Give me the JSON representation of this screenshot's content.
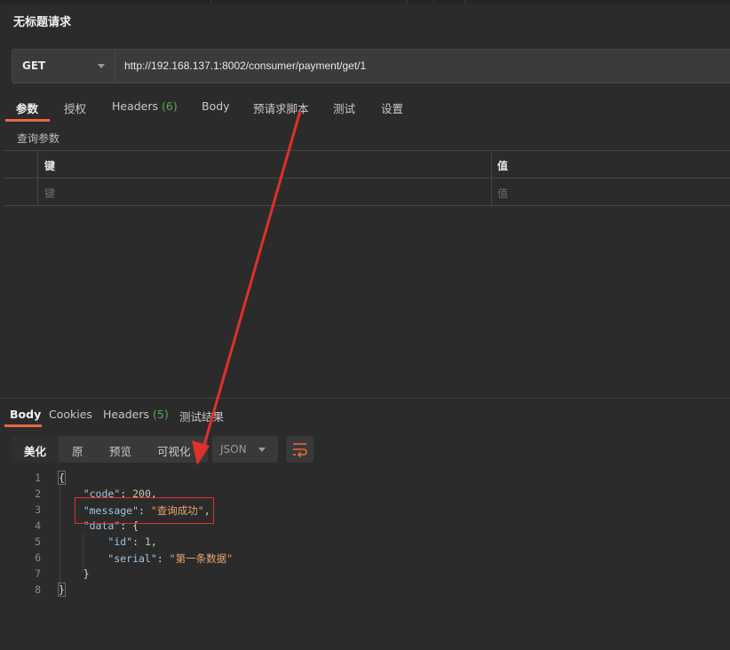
{
  "request": {
    "title": "无标题请求",
    "method": "GET",
    "url": "http://192.168.137.1:8002/consumer/payment/get/1"
  },
  "request_tabs": [
    {
      "label": "参数",
      "active": true
    },
    {
      "label": "授权"
    },
    {
      "label": "Headers",
      "count": "(6)"
    },
    {
      "label": "Body"
    },
    {
      "label": "预请求脚本"
    },
    {
      "label": "测试"
    },
    {
      "label": "设置"
    }
  ],
  "params": {
    "section_title": "查询参数",
    "columns": [
      "键",
      "值"
    ],
    "placeholders": [
      "键",
      "值"
    ]
  },
  "response_tabs": [
    {
      "label": "Body",
      "active": true
    },
    {
      "label": "Cookies"
    },
    {
      "label": "Headers",
      "count": "(5)"
    },
    {
      "label": "测试结果"
    }
  ],
  "view_modes": [
    {
      "label": "美化",
      "active": true
    },
    {
      "label": "原"
    },
    {
      "label": "预览"
    },
    {
      "label": "可视化"
    }
  ],
  "format_select": {
    "value": "JSON"
  },
  "wrap_icon": "wrap-lines-icon",
  "response_body": {
    "line_numbers": [
      "1",
      "2",
      "3",
      "4",
      "5",
      "6",
      "7",
      "8"
    ],
    "lines": [
      [
        "{"
      ],
      [
        "\"code\"",
        ": ",
        "200",
        ","
      ],
      [
        "\"message\"",
        ": ",
        "\"查询成功\"",
        ","
      ],
      [
        "\"data\"",
        ": {"
      ],
      [
        "\"id\"",
        ": ",
        "1",
        ","
      ],
      [
        "\"serial\"",
        ": ",
        "\"第一条数据\""
      ],
      [
        "}"
      ],
      [
        "}"
      ]
    ]
  },
  "colors": {
    "accent": "#e8693d",
    "annotation": "#e0302a",
    "count_badge": "#5aa55a"
  }
}
